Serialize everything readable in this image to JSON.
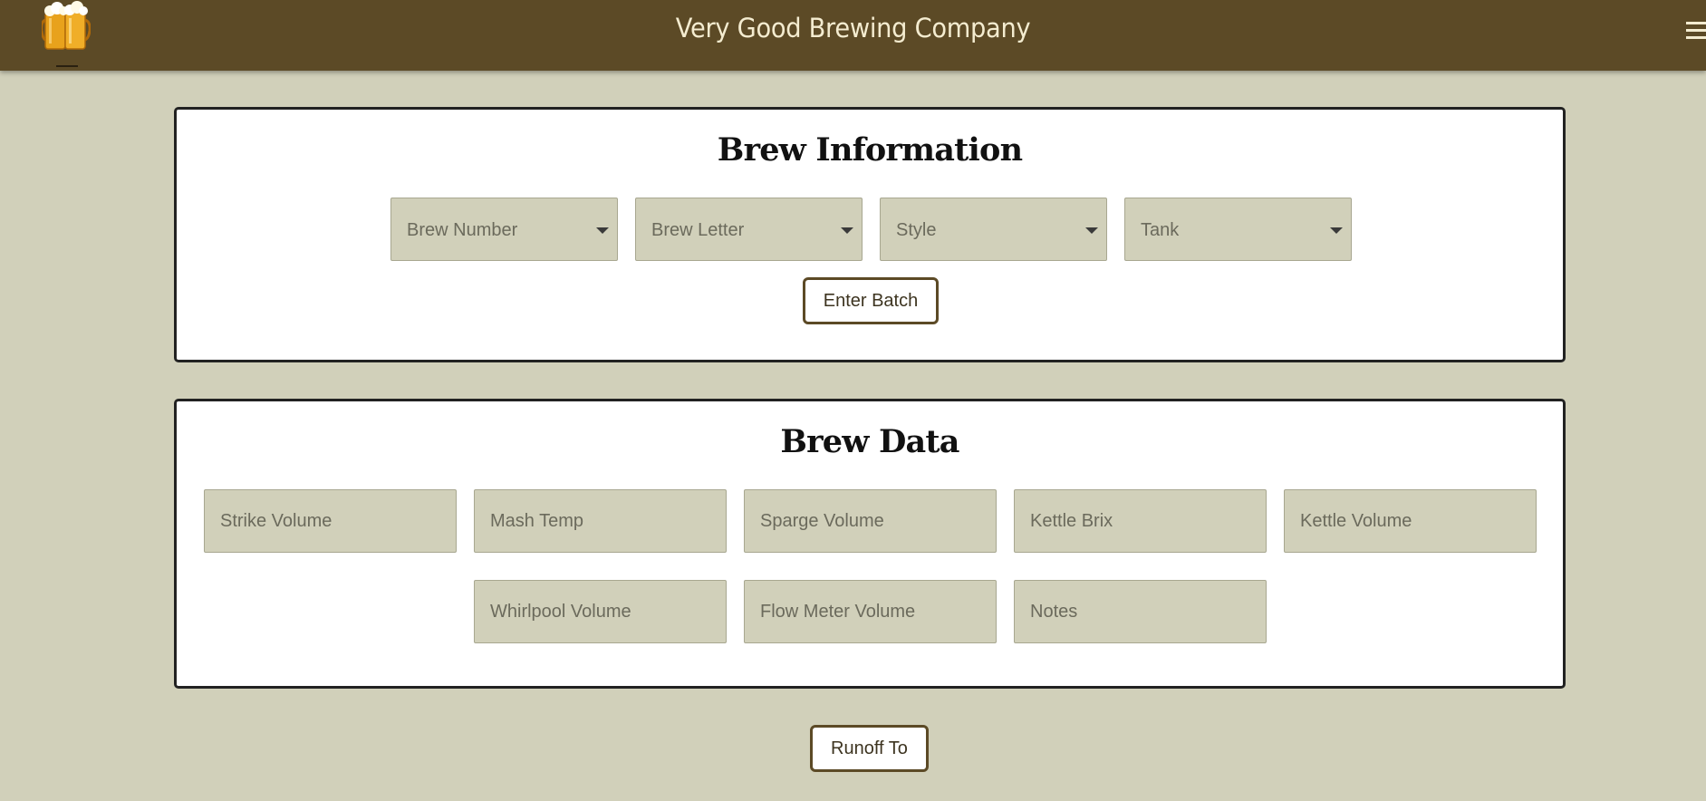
{
  "header": {
    "title": "Very Good Brewing Company",
    "logo": "beer-mugs-logo",
    "menu_icon": "hamburger-menu-icon"
  },
  "brew_information": {
    "title": "Brew Information",
    "selects": [
      {
        "label": "Brew Number"
      },
      {
        "label": "Brew Letter"
      },
      {
        "label": "Style"
      },
      {
        "label": "Tank"
      }
    ],
    "enter_batch_label": "Enter Batch"
  },
  "brew_data": {
    "title": "Brew Data",
    "fields": [
      {
        "placeholder": "Strike Volume"
      },
      {
        "placeholder": "Mash Temp"
      },
      {
        "placeholder": "Sparge Volume"
      },
      {
        "placeholder": "Kettle Brix"
      },
      {
        "placeholder": "Kettle Volume"
      },
      {
        "placeholder": "Whirlpool Volume"
      },
      {
        "placeholder": "Flow Meter Volume"
      },
      {
        "placeholder": "Notes"
      }
    ]
  },
  "runoff_label": "Runoff To",
  "colors": {
    "header_bg": "#5c4a26",
    "page_bg": "#d1d0ba",
    "header_text": "#f4ecd0",
    "button_border": "#5c4a26"
  }
}
